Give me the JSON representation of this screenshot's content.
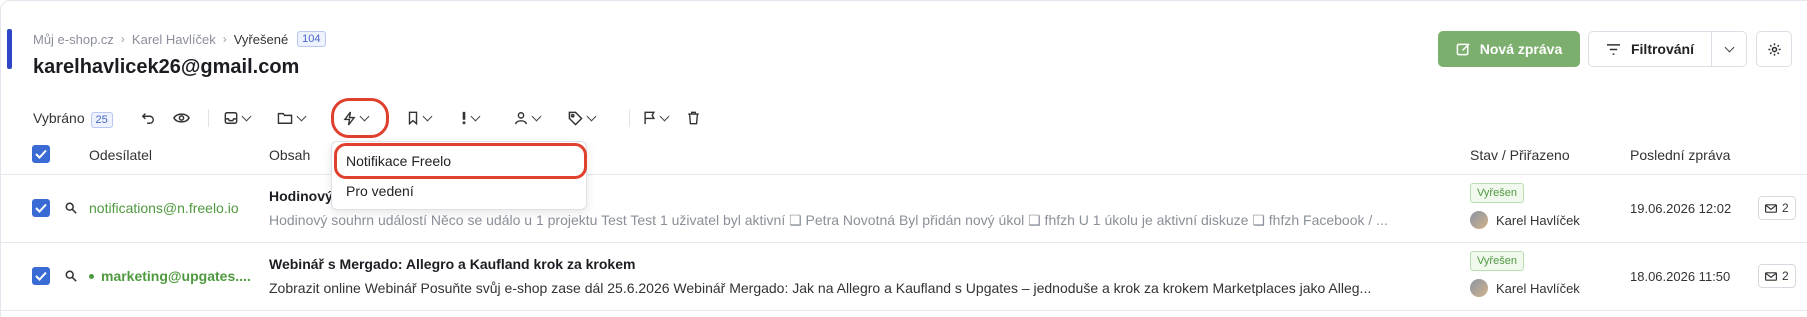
{
  "breadcrumb": {
    "items": [
      "Můj e-shop.cz",
      "Karel Havlíček",
      "Vyřešené"
    ],
    "count": "104"
  },
  "page": {
    "title": "karelhavlicek26@gmail.com"
  },
  "actions": {
    "new_message": "Nová zpráva",
    "filter": "Filtrování"
  },
  "toolbar": {
    "selected_label": "Vybráno",
    "selected_count": "25"
  },
  "table": {
    "headers": {
      "sender": "Odesílatel",
      "content": "Obsah",
      "status": "Stav / Přiřazeno",
      "last": "Poslední zpráva"
    },
    "rows": [
      {
        "sender": "notifications@n.freelo.io",
        "subject": "Hodinový",
        "preview": "Hodinový souhrn událostí Něco se událo u 1 projektu Test Test 1 uživatel byl aktivní ❏ Petra Novotná Byl přidán nový úkol ❏ fhfzh U 1 úkolu je aktivní diskuze ❏ fhfzh Facebook / ...",
        "status": "Vyřešen",
        "assignee": "Karel Havlíček",
        "date": "19.06.2026 12:02",
        "count": "2"
      },
      {
        "sender": "marketing@upgates....",
        "subject": "Webinář s Mergado: Allegro a Kaufland krok za krokem",
        "preview": "Zobrazit online Webinář Posuňte svůj e-shop zase dál 25.6.2026 Webinář Mergado: Jak na Allegro a Kaufland s Upgates – jednoduše a krok za krokem Marketplaces jako Alleg...",
        "status": "Vyřešen",
        "assignee": "Karel Havlíček",
        "date": "18.06.2026 11:50",
        "count": "2"
      }
    ]
  },
  "dropdown": {
    "items": [
      "Notifikace Freelo",
      "Pro vedení"
    ]
  },
  "colors": {
    "primary_green": "#7caf6d",
    "accent_blue": "#3a6ad4",
    "highlight_red": "#e0412e"
  }
}
